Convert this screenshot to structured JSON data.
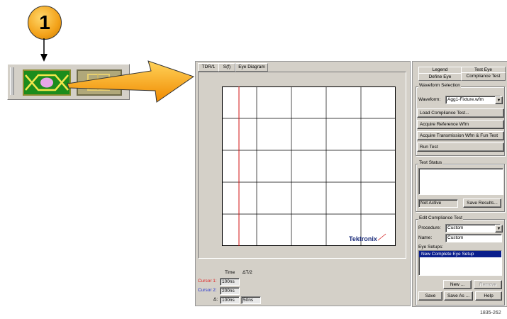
{
  "callout": {
    "number": "1"
  },
  "toolbar": {
    "eye_icon": "eye-diagram-icon",
    "compliance_icon": "compliance-test-icon"
  },
  "display": {
    "tabs": [
      "TDR/1",
      "S(f)",
      "Eye Diagram"
    ],
    "logo": "Tektronix"
  },
  "readout": {
    "headers": {
      "time": "Time",
      "delta": "ΔT/2"
    },
    "cursor1": {
      "label": "Cursor 1:",
      "value": "100ns",
      "color": "#e02020"
    },
    "cursor2": {
      "label": "Cursor 2:",
      "value": "200ns",
      "color": "#2030d0"
    },
    "delta": {
      "label": "Δ:",
      "value": "100ns",
      "half": "50ns"
    }
  },
  "panel": {
    "tabs_back": [
      "Legend",
      "Test Eye"
    ],
    "tabs_front": [
      "Define Eye",
      "Compliance Test"
    ],
    "waveform_selection": {
      "title": "Waveform Selection",
      "waveform_label": "Waveform:",
      "waveform_value": "Agg1-Fixture.wfm",
      "buttons": [
        "Load Compliance Test...",
        "Acquire Reference Wfm",
        "Acquire Transmission Wfm & Fun Test",
        "Run Test"
      ]
    },
    "test_status": {
      "title": "Test Status",
      "status": "Not Active",
      "save_results": "Save Results..."
    },
    "edit_compliance": {
      "title": "Edit Compliance Test",
      "procedure_label": "Procedure:",
      "procedure_value": "Custom",
      "name_label": "Name:",
      "name_value": "Custom",
      "eye_setups_label": "Eye Setups:",
      "eye_setups": [
        "New Complete Eye Setup"
      ],
      "new_button": "New ...",
      "remove_button": "Remove",
      "save_button": "Save",
      "save_as_button": "Save As ...",
      "help_button": "Help"
    }
  },
  "figure_id": "1835-262"
}
